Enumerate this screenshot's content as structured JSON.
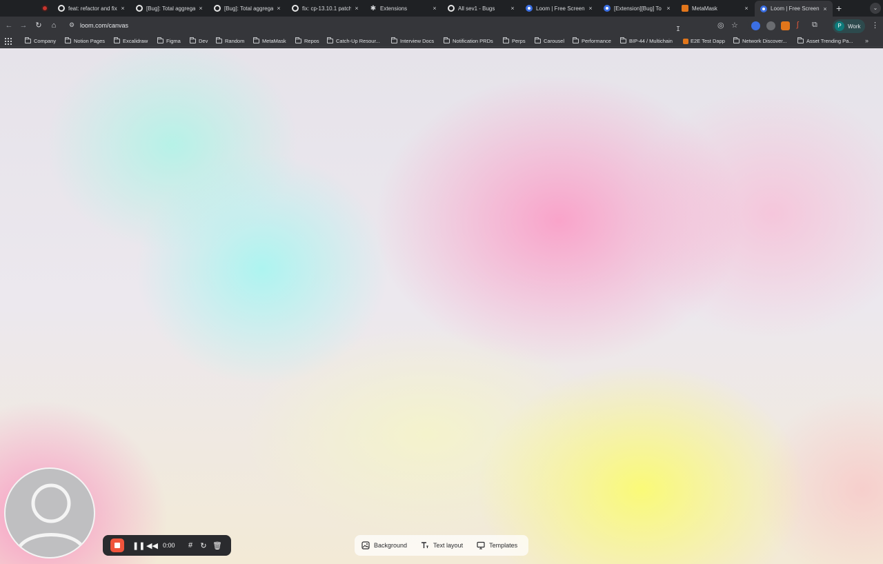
{
  "tabs": [
    {
      "title": "",
      "favicon": "record-icon",
      "close": "×"
    },
    {
      "title": "feat: refactor and fix",
      "favicon": "github-icon",
      "close": "×"
    },
    {
      "title": "[Bug]: Total aggrega",
      "favicon": "github-icon",
      "close": "×"
    },
    {
      "title": "[Bug]: Total aggrega",
      "favicon": "github-icon",
      "close": "×"
    },
    {
      "title": "fix: cp-13.10.1 patch",
      "favicon": "github-icon",
      "close": "×"
    },
    {
      "title": "Extensions",
      "favicon": "puzzle-icon",
      "close": "×"
    },
    {
      "title": "All sev1 - Bugs",
      "favicon": "github-icon",
      "close": "×"
    },
    {
      "title": "Loom | Free Screen",
      "favicon": "loom-icon",
      "close": "×"
    },
    {
      "title": "[Extension][Bug] To",
      "favicon": "loom-icon",
      "close": "×"
    },
    {
      "title": "MetaMask",
      "favicon": "metamask-icon",
      "close": "×"
    },
    {
      "title": "Loom | Free Screen",
      "favicon": "loom-icon",
      "close": "×",
      "active": true
    }
  ],
  "new_tab": "+",
  "tab_menu": "⌄",
  "address_bar": {
    "url": "loom.com/canvas"
  },
  "profile": {
    "initial": "P",
    "label": "Work"
  },
  "bookmarks": [
    {
      "label": "Company",
      "icon": "folder-icon"
    },
    {
      "label": "Notion Pages",
      "icon": "folder-icon"
    },
    {
      "label": "Excalidraw",
      "icon": "folder-icon"
    },
    {
      "label": "Figma",
      "icon": "folder-icon"
    },
    {
      "label": "Dev",
      "icon": "folder-icon"
    },
    {
      "label": "Random",
      "icon": "folder-icon"
    },
    {
      "label": "MetaMask",
      "icon": "folder-icon"
    },
    {
      "label": "Repos",
      "icon": "folder-icon"
    },
    {
      "label": "Catch-Up Resour...",
      "icon": "folder-icon"
    },
    {
      "label": "Interview Docs",
      "icon": "folder-icon"
    },
    {
      "label": "Notification PRDs",
      "icon": "folder-icon"
    },
    {
      "label": "Perps",
      "icon": "folder-icon"
    },
    {
      "label": "Carousel",
      "icon": "folder-icon"
    },
    {
      "label": "Performance",
      "icon": "folder-icon"
    },
    {
      "label": "BIP-44 / Multichain",
      "icon": "folder-icon"
    },
    {
      "label": "E2E Test Dapp",
      "icon": "metamask-icon"
    },
    {
      "label": "Network Discover...",
      "icon": "folder-icon"
    },
    {
      "label": "Asset Trending Pa...",
      "icon": "folder-icon"
    }
  ],
  "bookmarks_overflow": "»",
  "recording_controls": {
    "timer": "0:00"
  },
  "canvas_options": [
    {
      "label": "Background",
      "icon": "image-icon"
    },
    {
      "label": "Text layout",
      "icon": "text-layout-icon"
    },
    {
      "label": "Templates",
      "icon": "monitor-icon"
    }
  ],
  "colors": {
    "record_red": "#f0543c",
    "tab_bar": "#1f2124",
    "toolbar": "#35363a",
    "loom_blue": "#3b6fe3",
    "metamask_orange": "#e2761b"
  }
}
